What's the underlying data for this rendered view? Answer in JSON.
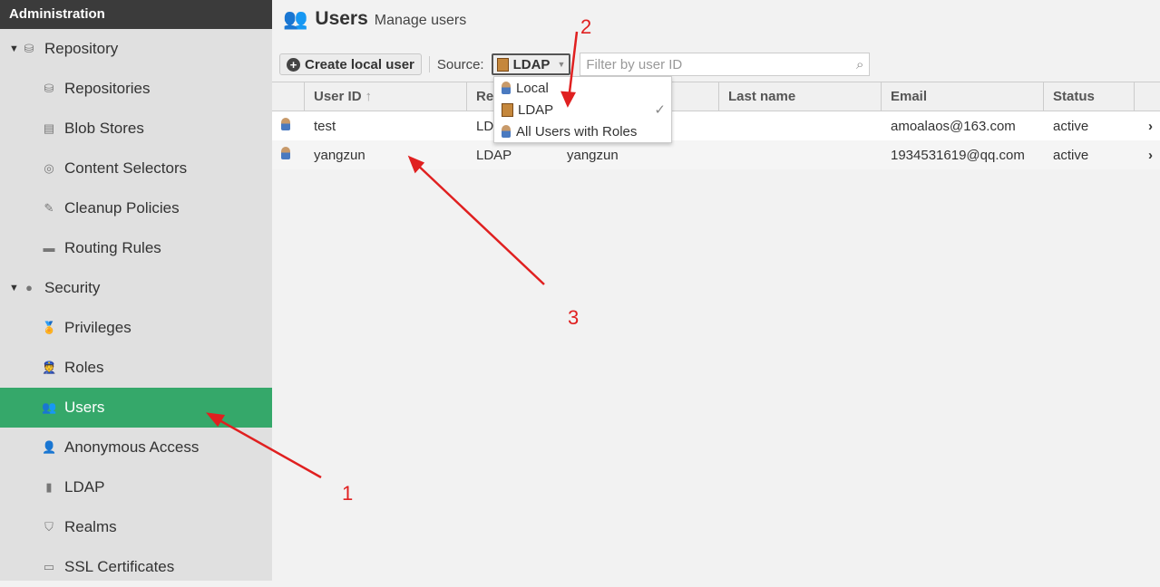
{
  "sidebar": {
    "header": "Administration",
    "items": [
      {
        "label": "Repository",
        "type": "group",
        "icon": "database-icon"
      },
      {
        "label": "Repositories",
        "type": "child",
        "icon": "database-icon"
      },
      {
        "label": "Blob Stores",
        "type": "child",
        "icon": "server-icon"
      },
      {
        "label": "Content Selectors",
        "type": "child",
        "icon": "selector-icon"
      },
      {
        "label": "Cleanup Policies",
        "type": "child",
        "icon": "broom-icon"
      },
      {
        "label": "Routing Rules",
        "type": "child",
        "icon": "router-icon"
      },
      {
        "label": "Security",
        "type": "group",
        "icon": "security-cap-icon"
      },
      {
        "label": "Privileges",
        "type": "child",
        "icon": "medal-icon"
      },
      {
        "label": "Roles",
        "type": "child",
        "icon": "officer-icon"
      },
      {
        "label": "Users",
        "type": "child",
        "icon": "users-icon",
        "active": true
      },
      {
        "label": "Anonymous Access",
        "type": "child",
        "icon": "person-icon"
      },
      {
        "label": "LDAP",
        "type": "child",
        "icon": "address-book-icon"
      },
      {
        "label": "Realms",
        "type": "child",
        "icon": "shield-icon"
      },
      {
        "label": "SSL Certificates",
        "type": "child",
        "icon": "certificate-icon"
      }
    ]
  },
  "header": {
    "title": "Users",
    "subtitle": "Manage users"
  },
  "toolbar": {
    "create_label": "Create local user",
    "source_label": "Source:",
    "source_value": "LDAP",
    "filter_placeholder": "Filter by user ID"
  },
  "source_options": [
    {
      "label": "Local"
    },
    {
      "label": "LDAP",
      "selected": true
    },
    {
      "label": "All Users with Roles"
    }
  ],
  "table": {
    "columns": [
      "",
      "User ID",
      "Realm",
      "",
      "Last name",
      "Email",
      "Status",
      ""
    ],
    "sort_icon": "arrow-up-icon",
    "rows": [
      {
        "user_id": "test",
        "realm": "LDAP",
        "first_name": "",
        "last_name": "",
        "email": "amoalaos@163.com",
        "status": "active"
      },
      {
        "user_id": "yangzun",
        "realm": "LDAP",
        "first_name": "yangzun",
        "last_name": "",
        "email": "1934531619@qq.com",
        "status": "active"
      }
    ]
  },
  "annotations": [
    "1",
    "2",
    "3"
  ],
  "colors": {
    "active_nav": "#35a86a",
    "annotation": "#e02020",
    "header_bg": "#3b3b3b"
  }
}
